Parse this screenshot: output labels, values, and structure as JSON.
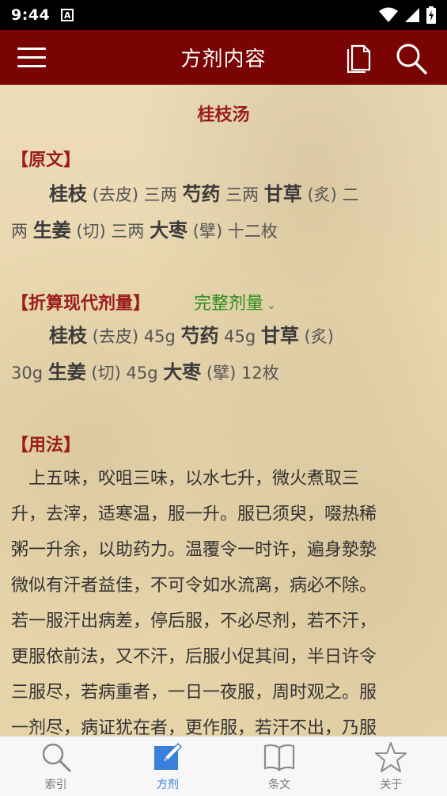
{
  "status_bar": {
    "time": "9:44",
    "notification_glyph": "A"
  },
  "appbar": {
    "title": "方剂内容"
  },
  "formula": {
    "name": "桂枝汤",
    "original_section": "【原文】",
    "original_lines": [
      [
        {
          "herb": "桂枝"
        },
        {
          "note": " (去皮) 三两 "
        },
        {
          "herb": "芍药"
        },
        {
          "note": " 三两 "
        },
        {
          "herb": "甘草"
        },
        {
          "note": " (炙) 二"
        }
      ],
      [
        {
          "note": "两 "
        },
        {
          "herb": "生姜"
        },
        {
          "note": " (切) 三两 "
        },
        {
          "herb": "大枣"
        },
        {
          "note": " (擘) 十二枚"
        }
      ]
    ],
    "modern_section": "【折算现代剂量】",
    "full_dose_label": "完整剂量",
    "modern_lines": [
      [
        {
          "herb": "桂枝"
        },
        {
          "note": " (去皮)  45g   "
        },
        {
          "herb": "芍药"
        },
        {
          "note": "  45g   "
        },
        {
          "herb": "甘草"
        },
        {
          "note": " (炙)"
        }
      ],
      [
        {
          "note": "30g   "
        },
        {
          "herb": "生姜"
        },
        {
          "note": " (切)  45g   "
        },
        {
          "herb": "大枣"
        },
        {
          "note": " (擘)  12枚"
        }
      ]
    ],
    "usage_section": "【用法】",
    "usage_lines": [
      "　上五味，㕮咀三味，以水七升，微火煮取三",
      "升，去滓，适寒温，服一升。服已须臾，啜热稀",
      "粥一升余，以助药力。温覆令一时许，遍身漐漐",
      "微似有汗者益佳，不可令如水流离，病必不除。",
      "若一服汗出病差，停后服，不必尽剂，若不汗，",
      "更服依前法，又不汗，后服小促其间，半日许令",
      "三服尽，若病重者，一日一夜服，周时观之。服",
      "一剂尽，病证犹在者，更作服，若汗不出，乃服"
    ]
  },
  "tabs": [
    {
      "label": "索引",
      "icon": "search-icon",
      "active": false
    },
    {
      "label": "方剂",
      "icon": "edit-icon",
      "active": true
    },
    {
      "label": "条文",
      "icon": "book-icon",
      "active": false
    },
    {
      "label": "关于",
      "icon": "star-icon",
      "active": false
    }
  ],
  "colors": {
    "appbar": "#7a0303",
    "section": "#9b1c1c",
    "full_dose": "#2a8c1a",
    "active_tab": "#3a7fd9"
  }
}
